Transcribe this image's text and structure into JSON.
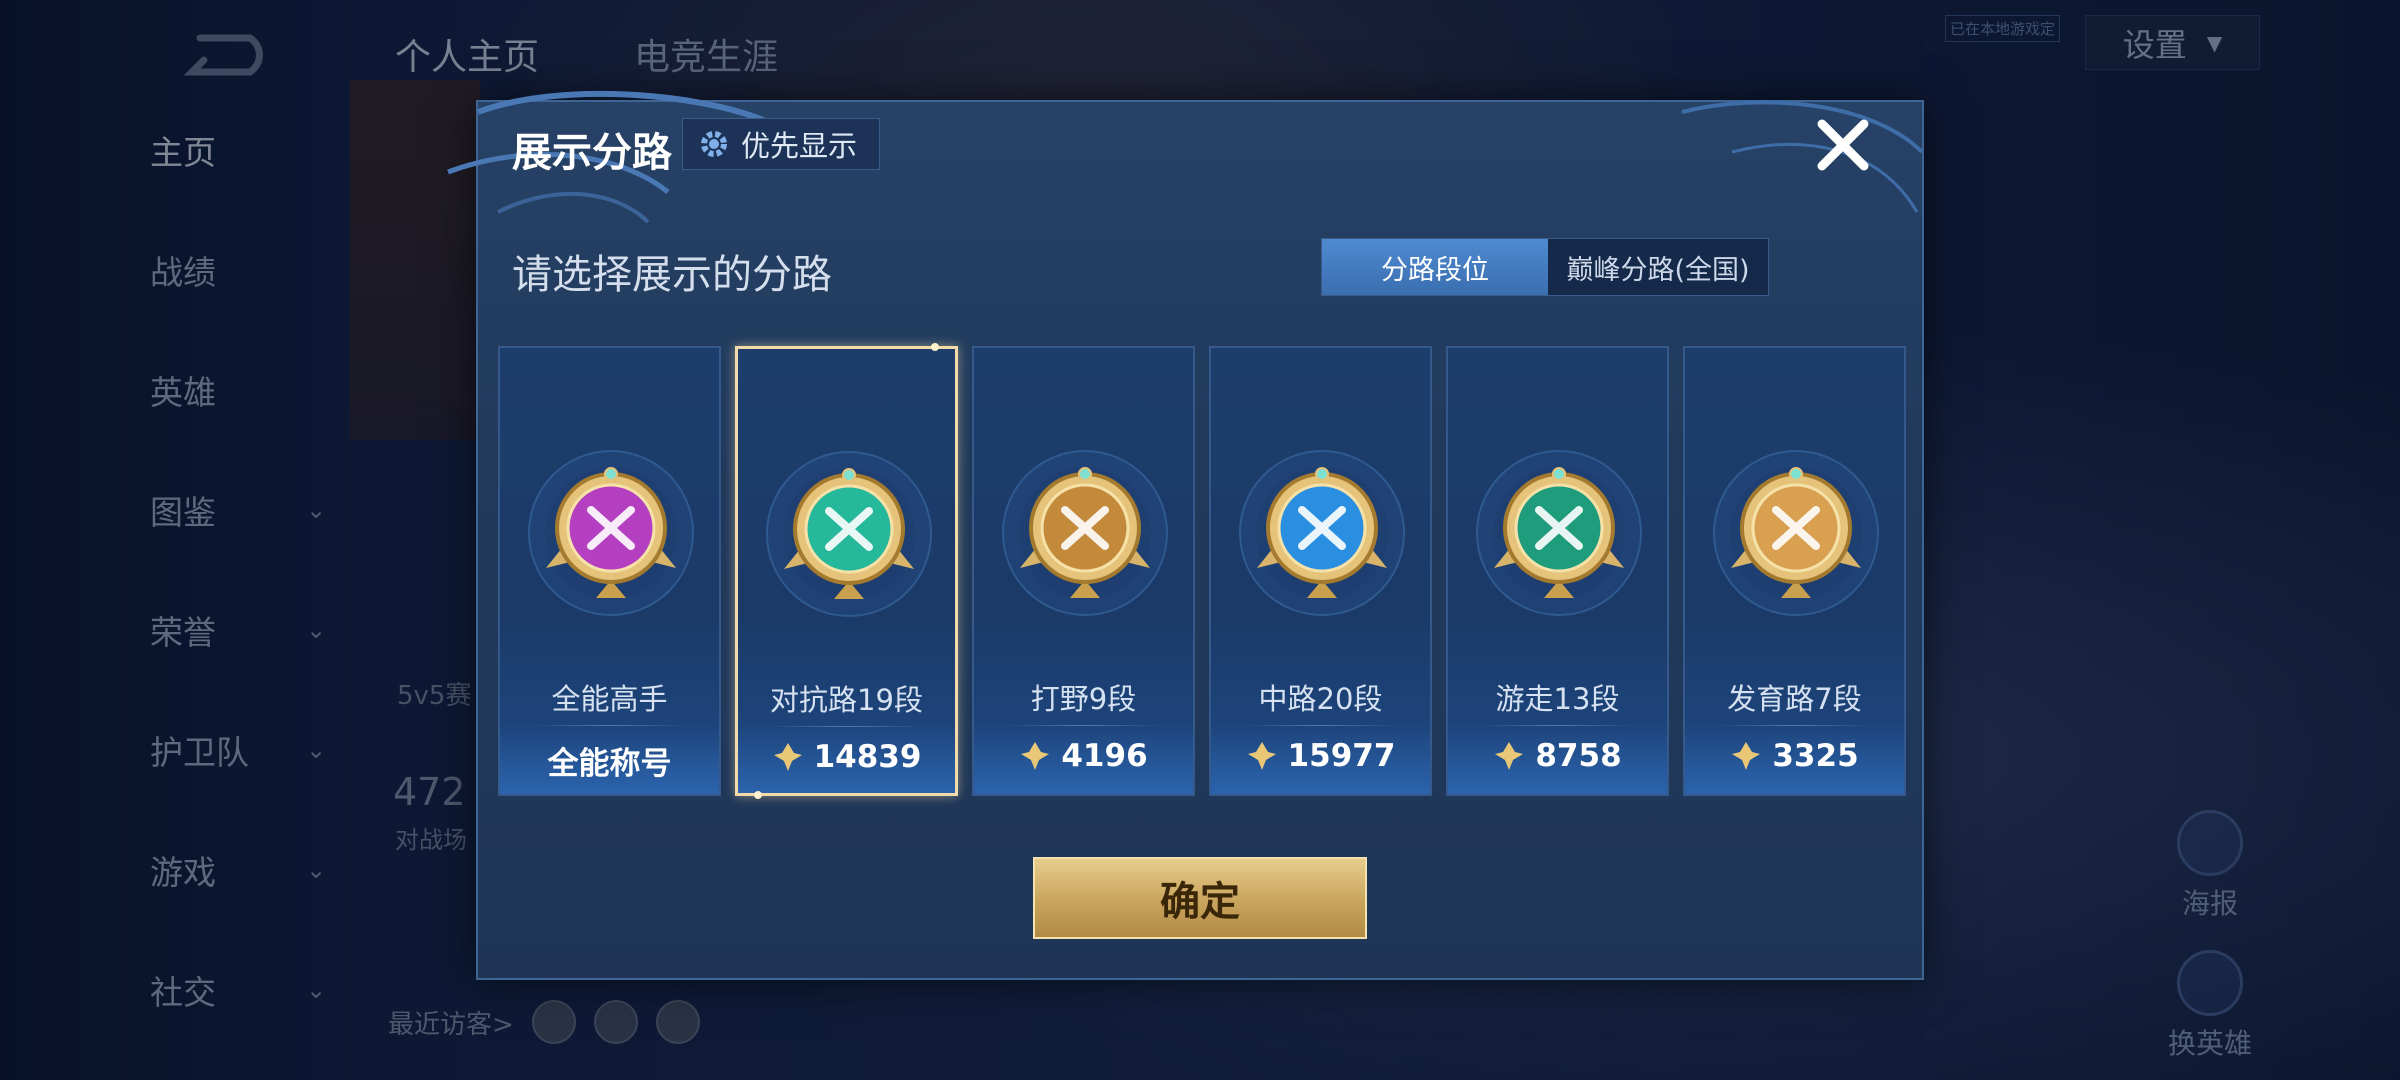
{
  "background": {
    "top_tabs": [
      "个人主页",
      "电竞生涯"
    ],
    "settings_label": "设置",
    "badge_text": "已在本地游戏定",
    "sidebar": [
      {
        "label": "主页",
        "active": true,
        "has_chevron": false
      },
      {
        "label": "战绩",
        "active": false,
        "has_chevron": false
      },
      {
        "label": "英雄",
        "active": false,
        "has_chevron": false
      },
      {
        "label": "图鉴",
        "active": false,
        "has_chevron": true
      },
      {
        "label": "荣誉",
        "active": false,
        "has_chevron": true
      },
      {
        "label": "护卫队",
        "active": false,
        "has_chevron": true
      },
      {
        "label": "游戏",
        "active": false,
        "has_chevron": true
      },
      {
        "label": "社交",
        "active": false,
        "has_chevron": true
      }
    ],
    "partial_5v5": "5v5赛",
    "partial_stat": "472",
    "partial_stat_label": "对战场",
    "recent_visitors": "最近访客>",
    "right_icons": {
      "poster": "海报",
      "swap_hero": "换英雄"
    }
  },
  "modal": {
    "title": "展示分路",
    "priority_button": "优先显示",
    "subtitle": "请选择展示的分路",
    "segment": {
      "option1": "分路段位",
      "option2": "巅峰分路(全国)",
      "selected": "option1"
    },
    "cards": [
      {
        "label": "全能高手",
        "score": "全能称号",
        "show_score_icon": false,
        "selected": false,
        "badge_color": "#b43fc0",
        "icon": "all-round-badge-icon"
      },
      {
        "label": "对抗路19段",
        "score": "14839",
        "show_score_icon": true,
        "selected": true,
        "badge_color": "#25b89a",
        "icon": "clash-lane-badge-icon"
      },
      {
        "label": "打野9段",
        "score": "4196",
        "show_score_icon": true,
        "selected": false,
        "badge_color": "#c48a3c",
        "icon": "jungle-badge-icon"
      },
      {
        "label": "中路20段",
        "score": "15977",
        "show_score_icon": true,
        "selected": false,
        "badge_color": "#2a8fe0",
        "icon": "mid-lane-badge-icon"
      },
      {
        "label": "游走13段",
        "score": "8758",
        "show_score_icon": true,
        "selected": false,
        "badge_color": "#1f9c7c",
        "icon": "roam-badge-icon"
      },
      {
        "label": "发育路7段",
        "score": "3325",
        "show_score_icon": true,
        "selected": false,
        "badge_color": "#d8a050",
        "icon": "farm-lane-badge-icon"
      }
    ],
    "confirm_button": "确定"
  }
}
